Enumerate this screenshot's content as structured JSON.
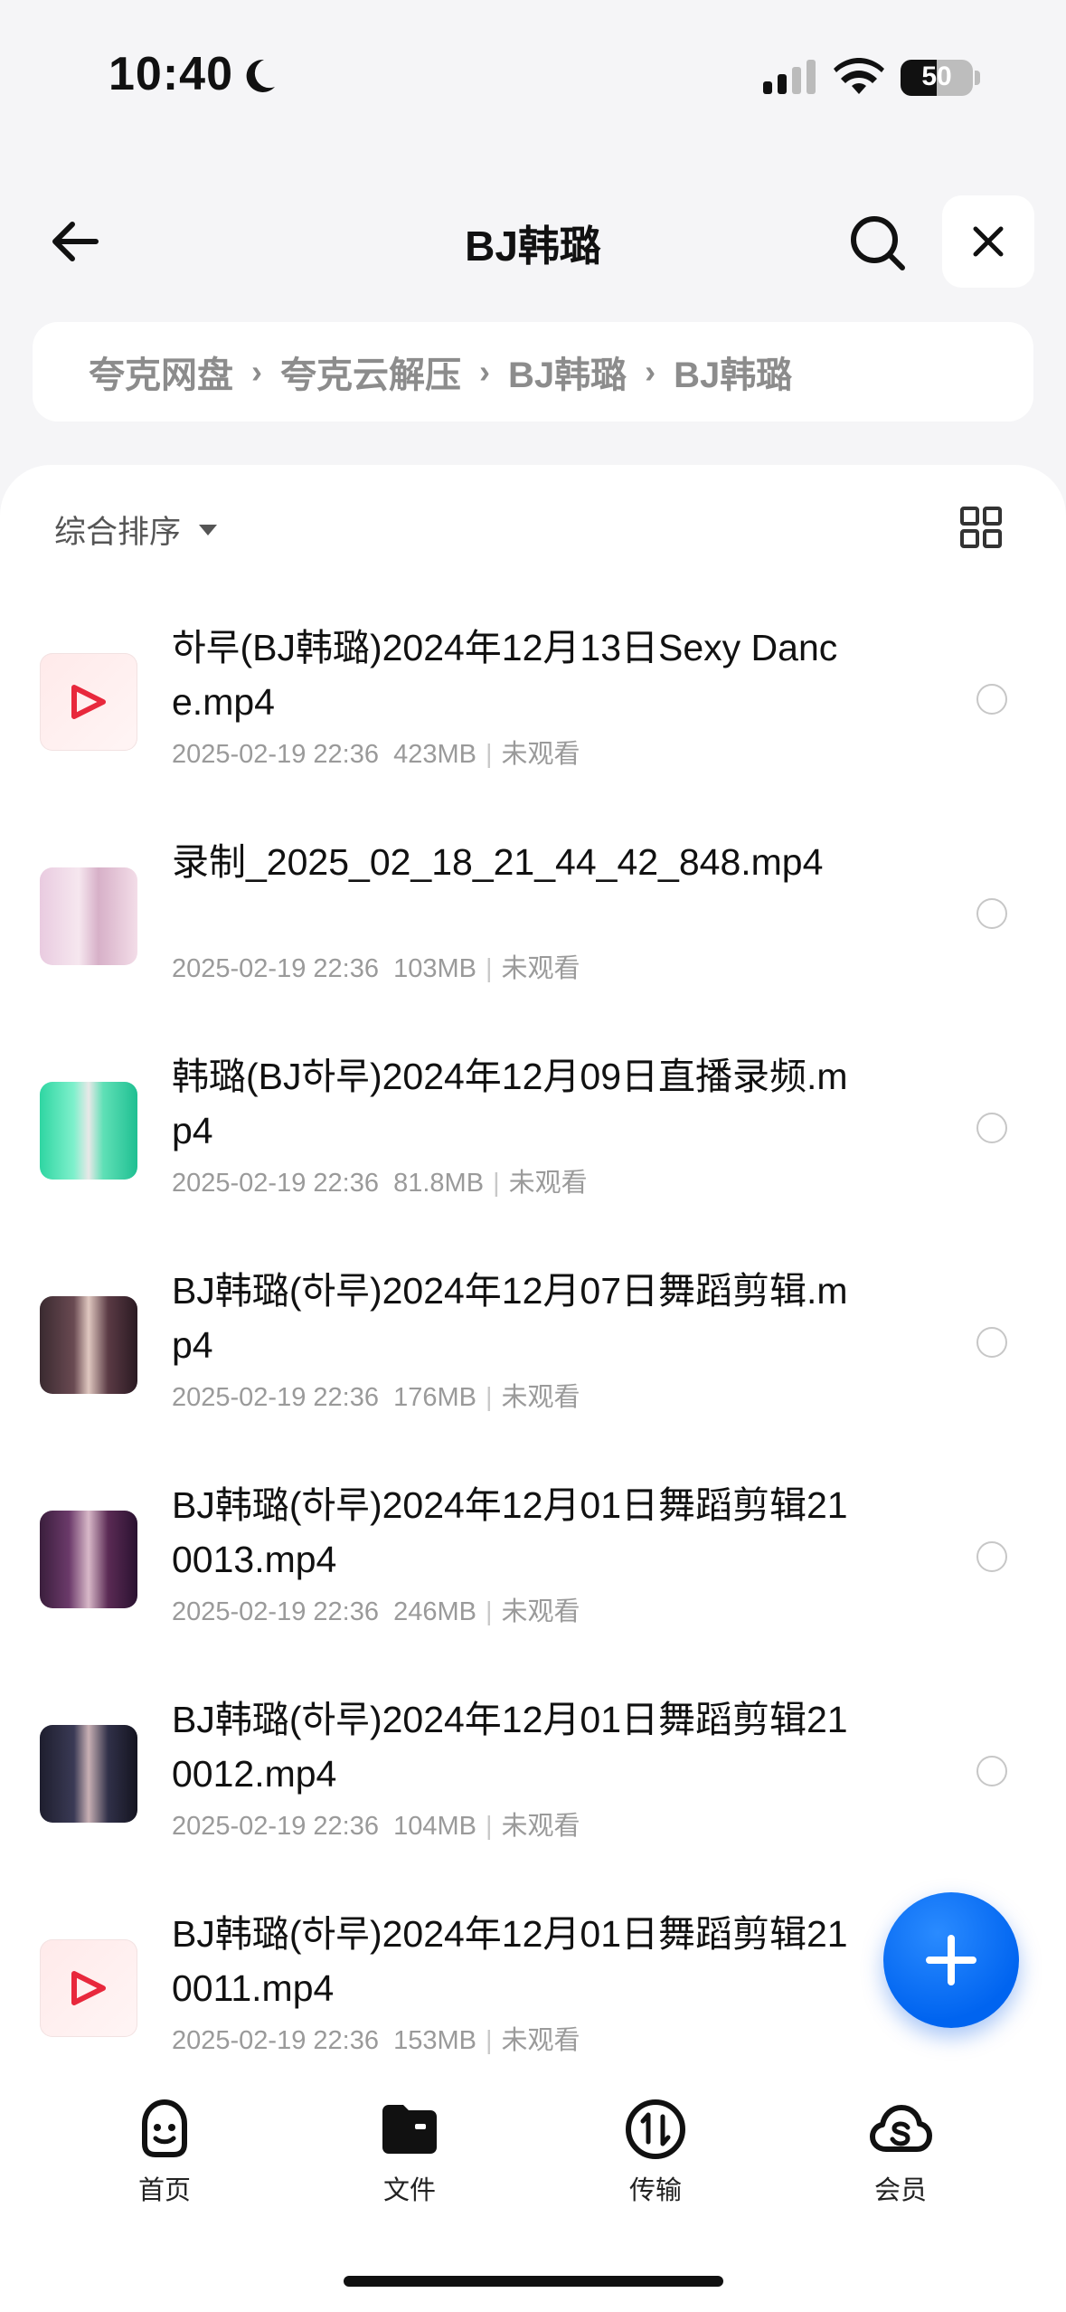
{
  "status_bar": {
    "time": "10:40",
    "battery": "50"
  },
  "header": {
    "title": "BJ韩璐"
  },
  "breadcrumb": [
    "夸克网盘",
    "夸克云解压",
    "BJ韩璐",
    "BJ韩璐"
  ],
  "toolbar": {
    "sort_label": "综合排序"
  },
  "files": [
    {
      "name": "하루(BJ韩璐)2024年12月13日Sexy Dance.mp4",
      "date": "2025-02-19 22:36",
      "size": "423MB",
      "status": "未观看",
      "thumb": "video-icon"
    },
    {
      "name": "录制_2025_02_18_21_44_42_848.mp4",
      "date": "2025-02-19 22:36",
      "size": "103MB",
      "status": "未观看",
      "thumb": "photo-pink"
    },
    {
      "name": "韩璐(BJ하루)2024年12月09日直播录频.mp4",
      "date": "2025-02-19 22:36",
      "size": "81.8MB",
      "status": "未观看",
      "thumb": "photo-teal"
    },
    {
      "name": "BJ韩璐(하루)2024年12月07日舞蹈剪辑.mp4",
      "date": "2025-02-19 22:36",
      "size": "176MB",
      "status": "未观看",
      "thumb": "photo-dark"
    },
    {
      "name": "BJ韩璐(하루)2024年12月01日舞蹈剪辑210013.mp4",
      "date": "2025-02-19 22:36",
      "size": "246MB",
      "status": "未观看",
      "thumb": "photo-purple"
    },
    {
      "name": "BJ韩璐(하루)2024年12月01日舞蹈剪辑210012.mp4",
      "date": "2025-02-19 22:36",
      "size": "104MB",
      "status": "未观看",
      "thumb": "photo-night"
    },
    {
      "name": "BJ韩璐(하루)2024年12月01日舞蹈剪辑210011.mp4",
      "date": "2025-02-19 22:36",
      "size": "153MB",
      "status": "未观看",
      "thumb": "video-icon"
    }
  ],
  "nav": [
    {
      "label": "首页",
      "icon": "smile-icon"
    },
    {
      "label": "文件",
      "icon": "folder-icon",
      "active": true
    },
    {
      "label": "传输",
      "icon": "transfer-icon"
    },
    {
      "label": "会员",
      "icon": "cloud-s-icon"
    }
  ],
  "colors": {
    "accent": "#0064f0",
    "video_red": "#e8283c"
  }
}
